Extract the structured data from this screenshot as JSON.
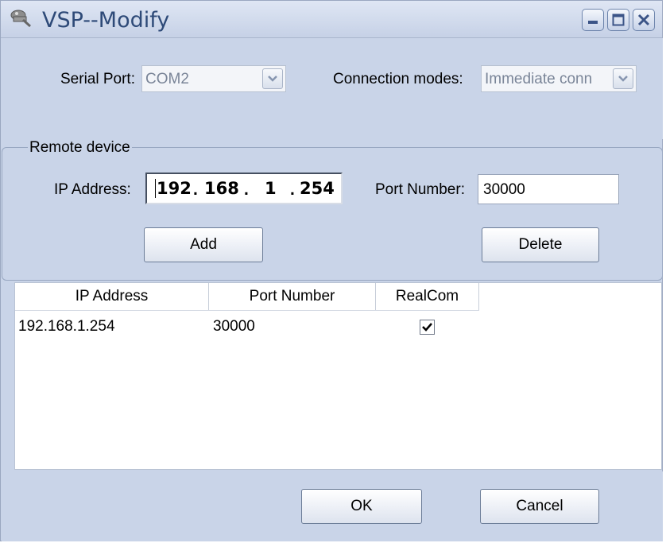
{
  "window": {
    "title": "VSP--Modify",
    "controls": [
      "minimize-icon",
      "maximize-icon",
      "close-icon"
    ]
  },
  "settings": {
    "serial_port_label": "Serial Port:",
    "serial_port_value": "COM2",
    "connection_modes_label": "Connection modes:",
    "connection_modes_value": "Immediate conn"
  },
  "remote_device": {
    "legend": "Remote device",
    "ip_label": "IP Address:",
    "ip_octets": [
      "192",
      "168",
      "1",
      "254"
    ],
    "port_label": "Port Number:",
    "port_value": "30000",
    "add_label": "Add",
    "delete_label": "Delete"
  },
  "table": {
    "columns": [
      "IP Address",
      "Port Number",
      "RealCom"
    ],
    "rows": [
      {
        "ip": "192.168.1.254",
        "port": "30000",
        "realcom": true
      }
    ]
  },
  "footer": {
    "ok_label": "OK",
    "cancel_label": "Cancel"
  },
  "colors": {
    "window_bg": "#c9d4e8",
    "title_text": "#2e4a78",
    "disabled_text": "#7a8598"
  }
}
